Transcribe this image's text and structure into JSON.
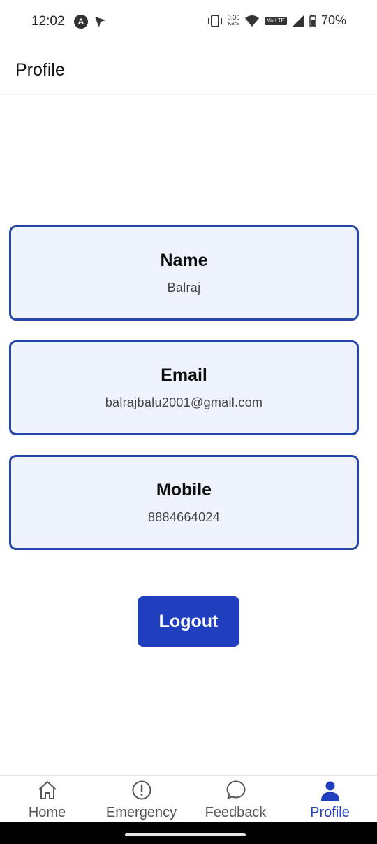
{
  "status_bar": {
    "time": "12:02",
    "net_speed_value": "0.36",
    "net_speed_unit": "KB/S",
    "volte": "Vo LTE",
    "battery": "70%"
  },
  "header": {
    "title": "Profile"
  },
  "profile": {
    "name": {
      "label": "Name",
      "value": "Balraj"
    },
    "email": {
      "label": "Email",
      "value": "balrajbalu2001@gmail.com"
    },
    "mobile": {
      "label": "Mobile",
      "value": "8884664024"
    }
  },
  "logout_label": "Logout",
  "nav": {
    "items": [
      {
        "label": "Home",
        "icon": "home-icon"
      },
      {
        "label": "Emergency",
        "icon": "alert-circle-icon"
      },
      {
        "label": "Feedback",
        "icon": "chat-bubble-icon"
      },
      {
        "label": "Profile",
        "icon": "user-icon",
        "active": true
      }
    ]
  },
  "colors": {
    "accent": "#1f3fbf",
    "card_border": "#2546a8",
    "card_bg": "#eff3fd"
  }
}
